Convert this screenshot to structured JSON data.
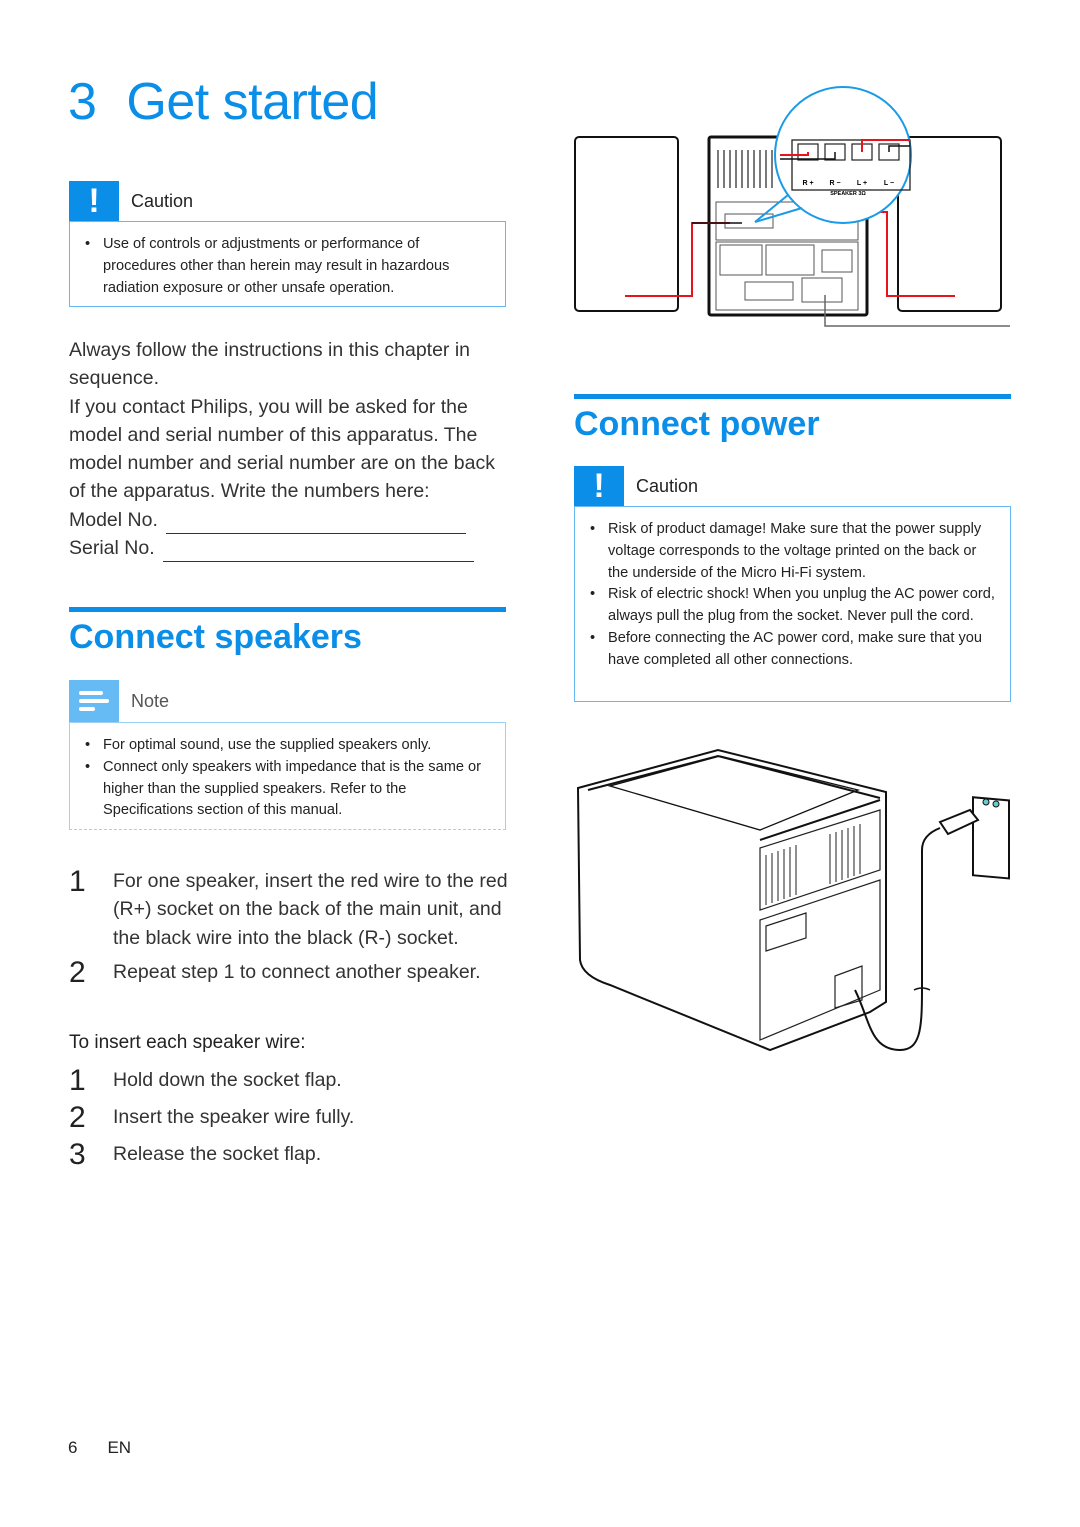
{
  "chapter": {
    "number": "3",
    "title": "Get started"
  },
  "caution_top": {
    "icon": "exclamation-icon",
    "label": "Caution",
    "items": [
      "Use of controls or adjustments or performance of procedures other than herein may result in hazardous radiation exposure or other unsafe operation."
    ]
  },
  "intro": {
    "paragraph1": "Always follow the instructions in this chapter in sequence.",
    "paragraph2": "If you contact Philips, you will be asked for the model and serial number of this apparatus. The model number and serial number are on the back of the apparatus. Write the numbers here:",
    "model_label": "Model No.",
    "serial_label": "Serial No."
  },
  "connect_speakers": {
    "title": "Connect speakers",
    "note": {
      "icon": "note-icon",
      "label": "Note",
      "items": [
        "For optimal sound, use the supplied speakers only.",
        "Connect only speakers with impedance that is the same or higher than the supplied speakers. Refer to the Specifications section of this manual."
      ]
    },
    "steps": [
      {
        "n": "1",
        "text": "For one speaker, insert the red wire to the red (R+) socket on the back of the main unit, and the black wire into the black (R-) socket."
      },
      {
        "n": "2",
        "text": "Repeat step 1 to connect another speaker."
      }
    ],
    "subheading": "To insert each speaker wire:",
    "substeps": [
      {
        "n": "1",
        "text": "Hold down the socket flap."
      },
      {
        "n": "2",
        "text": "Insert the speaker wire fully."
      },
      {
        "n": "3",
        "text": "Release the socket flap."
      }
    ]
  },
  "speaker_diagram": {
    "terminal_labels": [
      "R +",
      "R −",
      "L +",
      "L −"
    ],
    "terminal_caption": "SPEAKER 3Ω",
    "colors": {
      "red_wire": "#e8141c",
      "black_wire": "#111111",
      "magnifier": "#1a9be8"
    }
  },
  "connect_power": {
    "title": "Connect power",
    "caution": {
      "icon": "exclamation-icon",
      "label": "Caution",
      "items": [
        "Risk of product damage! Make sure that the power supply voltage corresponds to the voltage printed on the back or the underside of the Micro Hi-Fi system.",
        "Risk of electric shock! When you unplug the AC power cord, always pull the plug from the socket. Never pull the cord.",
        "Before connecting the AC power cord, make sure that you have completed all other connections."
      ]
    }
  },
  "footer": {
    "page": "6",
    "lang": "EN"
  },
  "colors": {
    "accent": "#0a8ee8",
    "note_accent": "#66bbf5"
  }
}
